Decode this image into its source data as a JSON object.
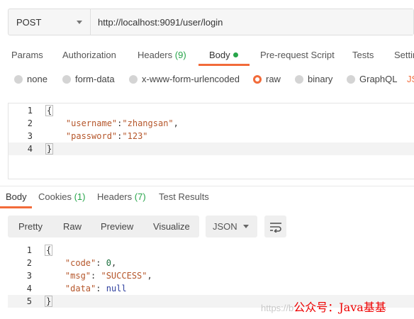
{
  "request": {
    "method": "POST",
    "url": "http://localhost:9091/user/login"
  },
  "request_tabs": [
    {
      "label": "Params"
    },
    {
      "label": "Authorization"
    },
    {
      "label": "Headers",
      "count": "(9)"
    },
    {
      "label": "Body",
      "active": true
    },
    {
      "label": "Pre-request Script"
    },
    {
      "label": "Tests"
    },
    {
      "label": "Settings"
    }
  ],
  "body_types": [
    {
      "label": "none"
    },
    {
      "label": "form-data"
    },
    {
      "label": "x-www-form-urlencoded"
    },
    {
      "label": "raw",
      "selected": true
    },
    {
      "label": "binary"
    },
    {
      "label": "GraphQL"
    },
    {
      "label": "JSON"
    }
  ],
  "request_body": {
    "line_numbers": [
      "1",
      "2",
      "3",
      "4"
    ],
    "open": "{",
    "k1": "\"username\"",
    "v1": "\"zhangsan\"",
    "k2": "\"password\"",
    "v2": "\"123\"",
    "close": "}"
  },
  "response_tabs": [
    {
      "label": "Body",
      "active": true
    },
    {
      "label": "Cookies",
      "count": "(1)"
    },
    {
      "label": "Headers",
      "count": "(7)"
    },
    {
      "label": "Test Results"
    }
  ],
  "response_toolbar": {
    "views": [
      "Pretty",
      "Raw",
      "Preview",
      "Visualize"
    ],
    "format": "JSON"
  },
  "response_body": {
    "line_numbers": [
      "1",
      "2",
      "3",
      "4",
      "5"
    ],
    "open": "{",
    "k1": "\"code\"",
    "v1": "0",
    "k2": "\"msg\"",
    "v2": "\"SUCCESS\"",
    "k3": "\"data\"",
    "v3": "null",
    "close": "}"
  },
  "watermark": {
    "faint": "https://b",
    "text": "公众号：Java基基"
  },
  "colors": {
    "accent": "#f26b3a",
    "count_green": "#27a54a"
  },
  "icons": {
    "method_dropdown": "caret-down-icon",
    "format_dropdown": "caret-down-icon",
    "wrap": "wrap-lines-icon"
  }
}
